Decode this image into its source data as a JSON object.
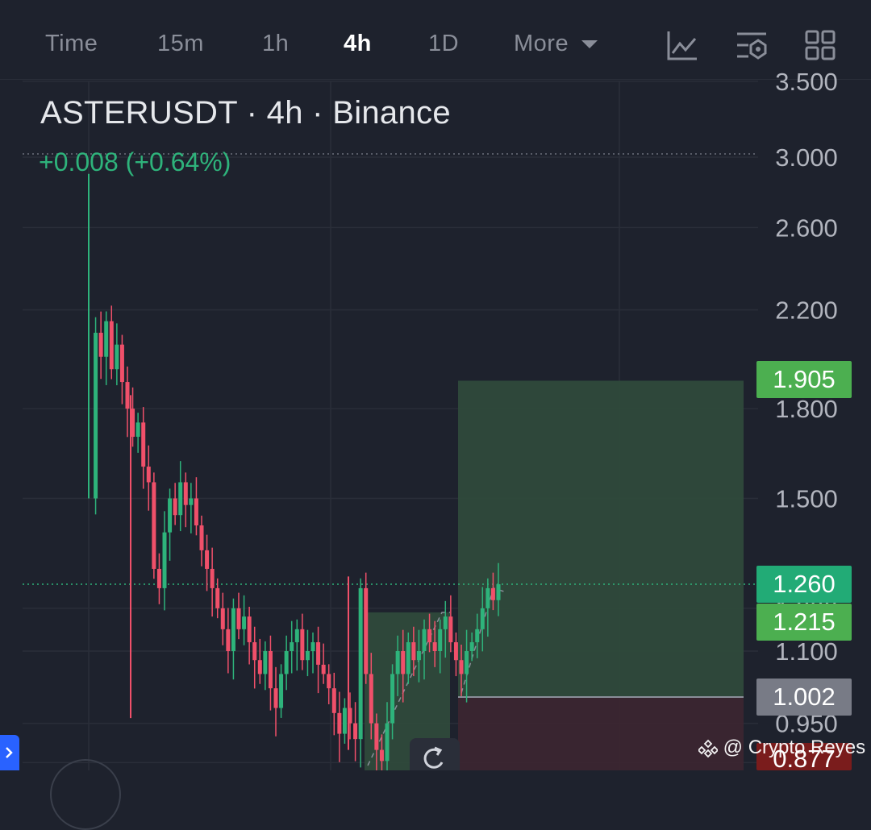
{
  "toolbar": {
    "timeframes": [
      "Time",
      "15m",
      "1h",
      "4h",
      "1D",
      "More"
    ],
    "active": "4h",
    "icons": [
      "line-chart-icon",
      "indicators-icon",
      "layout-grid-icon"
    ]
  },
  "header": {
    "symbol": "ASTERUSDT · 4h · Binance",
    "change": "+0.008 (+0.64%)"
  },
  "colors": {
    "up": "#2eb37b",
    "down": "#f0506a",
    "profit_zone": "#2f4a3b",
    "loss_zone": "#3b2630",
    "target_badge": "#4caf50",
    "last_price_badge": "#22ab76",
    "stop_badge": "#787b86"
  },
  "badges": {
    "target": "1.905",
    "last_price": "1.260",
    "entry": "1.215",
    "stop": "1.002",
    "partial": "0.877"
  },
  "watermark": "@ Crypto Reyes",
  "chart_data": {
    "type": "candlestick",
    "title": "ASTERUSDT · 4h · Binance",
    "y_ticks": [
      "3.500",
      "3.000",
      "2.600",
      "2.200",
      "1.800",
      "1.500",
      "1.200",
      "1.100",
      "0.950",
      "0.877"
    ],
    "y_range": [
      0.85,
      3.6
    ],
    "scale": "log",
    "close_series": [
      1.5,
      2.1,
      2.0,
      2.15,
      1.95,
      2.05,
      1.9,
      1.8,
      1.7,
      1.75,
      1.6,
      1.55,
      1.3,
      1.25,
      1.4,
      1.5,
      1.45,
      1.55,
      1.48,
      1.5,
      1.42,
      1.35,
      1.3,
      1.25,
      1.2,
      1.15,
      1.1,
      1.2,
      1.15,
      1.18,
      1.12,
      1.08,
      1.05,
      1.1,
      1.02,
      0.98,
      1.05,
      1.1,
      1.12,
      1.15,
      1.08,
      1.1,
      1.12,
      1.07,
      1.05,
      1.02,
      0.97,
      0.93,
      0.98,
      0.95,
      0.92,
      1.25,
      1.05,
      0.95,
      0.9,
      0.88,
      0.95,
      1.05,
      1.1,
      1.05,
      1.12,
      1.08,
      1.1,
      1.15,
      1.12,
      1.1,
      1.15,
      1.18,
      1.12,
      1.08,
      1.05,
      1.1,
      1.12,
      1.15,
      1.2,
      1.25,
      1.22,
      1.26
    ],
    "position": {
      "type": "long",
      "entry": 1.215,
      "target": 1.905,
      "stop": 1.002
    },
    "last_price": 1.26,
    "grid": true
  }
}
